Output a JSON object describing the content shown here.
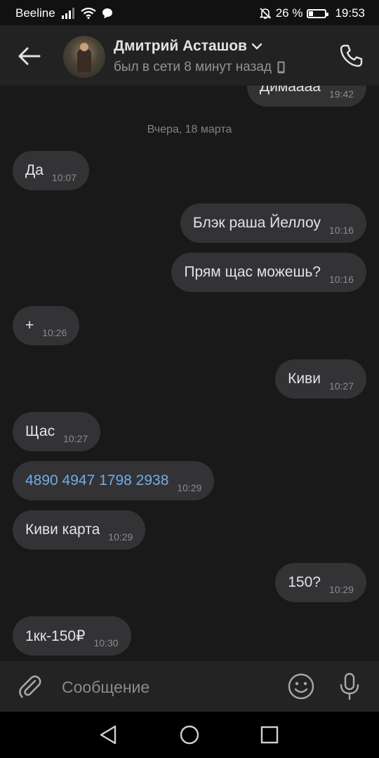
{
  "status_bar": {
    "carrier": "Beeline",
    "battery_text": "26 %",
    "battery_level": 0.26,
    "time": "19:53",
    "icons": [
      "signal-icon",
      "wifi-icon",
      "message-notification-icon",
      "mute-bell-icon",
      "battery-icon"
    ]
  },
  "header": {
    "contact_name": "Дмитрий Асташов",
    "status": "был в сети 8 минут назад",
    "icons": [
      "back-arrow-icon",
      "chevron-down-icon",
      "mobile-device-icon",
      "phone-call-icon"
    ]
  },
  "chat": {
    "top_partial": {
      "text": "Димаааа",
      "time": "19:42"
    },
    "date_separator": "Вчера, 18 марта",
    "messages": [
      {
        "direction": "in",
        "text": "Да",
        "time": "10:07"
      },
      {
        "direction": "out",
        "text": "Блэк раша Йеллоу",
        "time": "10:16"
      },
      {
        "direction": "out",
        "text": "Прям щас можешь?",
        "time": "10:16"
      },
      {
        "direction": "in",
        "text": "+",
        "time": "10:26"
      },
      {
        "direction": "out",
        "text": "Киви",
        "time": "10:27"
      },
      {
        "direction": "in",
        "text": "Щас",
        "time": "10:27"
      },
      {
        "direction": "in",
        "text": "4890 4947 1798 2938",
        "time": "10:29",
        "is_link": true
      },
      {
        "direction": "in",
        "text": "Киви карта",
        "time": "10:29"
      },
      {
        "direction": "out",
        "text": "150?",
        "time": "10:29"
      },
      {
        "direction": "in",
        "text": "1кк-150₽",
        "time": "10:30"
      }
    ]
  },
  "composer": {
    "placeholder": "Сообщение",
    "value": "",
    "icons": [
      "attach-icon",
      "emoji-icon",
      "microphone-icon"
    ]
  },
  "nav_bar": {
    "icons": [
      "back-triangle-icon",
      "home-circle-icon",
      "recents-square-icon"
    ]
  },
  "colors": {
    "background": "#19191a",
    "bubble": "#333335",
    "header": "#222223",
    "link": "#71aaeb",
    "text": "#e1e3e6",
    "muted": "#8b8b8d"
  }
}
